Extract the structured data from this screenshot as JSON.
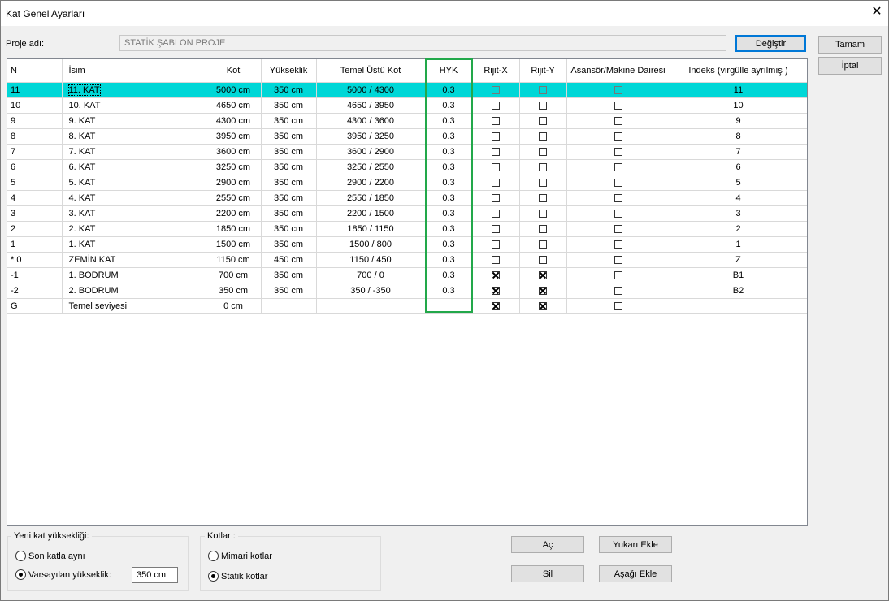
{
  "window": {
    "title": "Kat Genel Ayarları"
  },
  "project": {
    "label": "Proje adı:",
    "value": "STATİK ŞABLON PROJE",
    "change_label": "Değiştir"
  },
  "actions": {
    "ok_label": "Tamam",
    "cancel_label": "İptal"
  },
  "grid": {
    "columns": [
      "N",
      "İsim",
      "Kot",
      "Yükseklik",
      "Temel Üstü Kot",
      "HYK",
      "Rijit-X",
      "Rijit-Y",
      "Asansör/Makine Dairesi",
      "Indeks (virgülle ayrılmış )"
    ],
    "rows": [
      {
        "n": "11",
        "name": "11. KAT",
        "kot": "5000 cm",
        "height": "350 cm",
        "temel": "5000 / 4300",
        "hyk": "0.3",
        "rx": false,
        "ry": false,
        "lift": false,
        "index": "11",
        "selected": true
      },
      {
        "n": "10",
        "name": "10. KAT",
        "kot": "4650 cm",
        "height": "350 cm",
        "temel": "4650 / 3950",
        "hyk": "0.3",
        "rx": false,
        "ry": false,
        "lift": false,
        "index": "10"
      },
      {
        "n": "9",
        "name": "9. KAT",
        "kot": "4300 cm",
        "height": "350 cm",
        "temel": "4300 / 3600",
        "hyk": "0.3",
        "rx": false,
        "ry": false,
        "lift": false,
        "index": "9"
      },
      {
        "n": "8",
        "name": "8. KAT",
        "kot": "3950 cm",
        "height": "350 cm",
        "temel": "3950 / 3250",
        "hyk": "0.3",
        "rx": false,
        "ry": false,
        "lift": false,
        "index": "8"
      },
      {
        "n": "7",
        "name": "7. KAT",
        "kot": "3600 cm",
        "height": "350 cm",
        "temel": "3600 / 2900",
        "hyk": "0.3",
        "rx": false,
        "ry": false,
        "lift": false,
        "index": "7"
      },
      {
        "n": "6",
        "name": "6. KAT",
        "kot": "3250 cm",
        "height": "350 cm",
        "temel": "3250 / 2550",
        "hyk": "0.3",
        "rx": false,
        "ry": false,
        "lift": false,
        "index": "6"
      },
      {
        "n": "5",
        "name": "5. KAT",
        "kot": "2900 cm",
        "height": "350 cm",
        "temel": "2900 / 2200",
        "hyk": "0.3",
        "rx": false,
        "ry": false,
        "lift": false,
        "index": "5"
      },
      {
        "n": "4",
        "name": "4. KAT",
        "kot": "2550 cm",
        "height": "350 cm",
        "temel": "2550 / 1850",
        "hyk": "0.3",
        "rx": false,
        "ry": false,
        "lift": false,
        "index": "4"
      },
      {
        "n": "3",
        "name": "3. KAT",
        "kot": "2200 cm",
        "height": "350 cm",
        "temel": "2200 / 1500",
        "hyk": "0.3",
        "rx": false,
        "ry": false,
        "lift": false,
        "index": "3"
      },
      {
        "n": "2",
        "name": "2. KAT",
        "kot": "1850 cm",
        "height": "350 cm",
        "temel": "1850 / 1150",
        "hyk": "0.3",
        "rx": false,
        "ry": false,
        "lift": false,
        "index": "2"
      },
      {
        "n": "1",
        "name": "1. KAT",
        "kot": "1500 cm",
        "height": "350 cm",
        "temel": "1500 / 800",
        "hyk": "0.3",
        "rx": false,
        "ry": false,
        "lift": false,
        "index": "1"
      },
      {
        "n": "* 0",
        "name": "ZEMİN KAT",
        "kot": "1150 cm",
        "height": "450 cm",
        "temel": "1150 / 450",
        "hyk": "0.3",
        "rx": false,
        "ry": false,
        "lift": false,
        "index": "Z"
      },
      {
        "n": "-1",
        "name": "1. BODRUM",
        "kot": "700 cm",
        "height": "350 cm",
        "temel": "700 / 0",
        "hyk": "0.3",
        "rx": true,
        "ry": true,
        "lift": false,
        "index": "B1"
      },
      {
        "n": "-2",
        "name": "2. BODRUM",
        "kot": "350 cm",
        "height": "350 cm",
        "temel": "350 / -350",
        "hyk": "0.3",
        "rx": true,
        "ry": true,
        "lift": false,
        "index": "B2"
      },
      {
        "n": "G",
        "name": "Temel seviyesi",
        "kot": "0 cm",
        "height": "",
        "temel": "",
        "hyk": "",
        "rx": true,
        "ry": true,
        "lift": false,
        "index": ""
      }
    ]
  },
  "new_floor": {
    "title": "Yeni kat yüksekliği:",
    "option_last": "Son katla aynı",
    "option_default": "Varsayılan yükseklik:",
    "default_value": "350 cm",
    "selected": "default"
  },
  "levels": {
    "title": "Kotlar :",
    "option_arch": "Mimari kotlar",
    "option_static": "Statik kotlar",
    "selected": "static"
  },
  "buttons": {
    "open": "Aç",
    "delete": "Sil",
    "add_above": "Yukarı Ekle",
    "add_below": "Aşağı Ekle"
  }
}
